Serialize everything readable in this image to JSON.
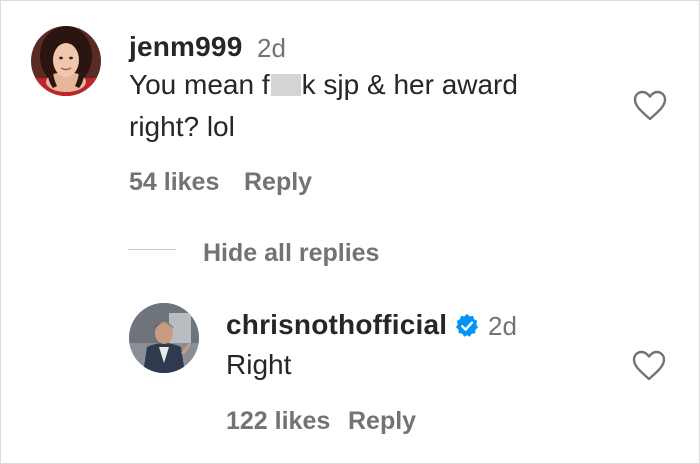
{
  "comment": {
    "username": "jenm999",
    "time": "2d",
    "text_line1_prefix": "You mean f",
    "text_line1_suffix": "k sjp & her award",
    "text_line2": "right? lol",
    "likes": "54 likes",
    "reply_label": "Reply"
  },
  "replies_toggle": {
    "label": "Hide all replies"
  },
  "reply": {
    "username": "chrisnothofficial",
    "verified": true,
    "time": "2d",
    "text": "Right",
    "likes": "122 likes",
    "reply_label": "Reply"
  },
  "colors": {
    "text_primary": "#262626",
    "text_secondary": "#737373",
    "verified_blue": "#0095f6"
  },
  "icons": {
    "like": "heart-outline-icon",
    "verified": "verified-badge-icon"
  }
}
